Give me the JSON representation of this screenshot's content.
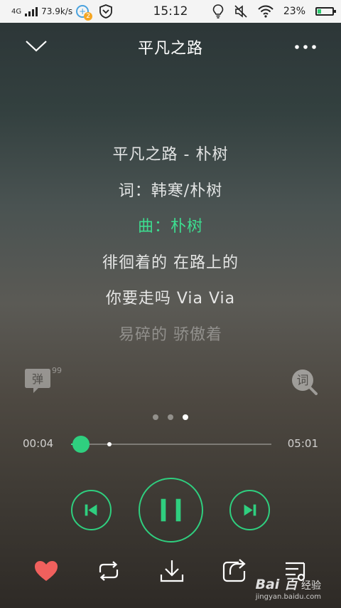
{
  "status_bar": {
    "network": "4G",
    "speed": "73.9k/s",
    "notification_count": "2",
    "time": "15:12",
    "battery_percent": "23%",
    "battery_level": 0.23
  },
  "header": {
    "title": "平凡之路"
  },
  "lyrics": [
    "平凡之路 - 朴树",
    "词：韩寒/朴树",
    "曲：朴树",
    "徘徊着的 在路上的",
    "你要走吗 Via Via",
    "易碎的 骄傲着"
  ],
  "active_lyric_index": 2,
  "danmu": {
    "label": "弹",
    "count": "99+"
  },
  "lyric_search": {
    "label": "词"
  },
  "pager": {
    "count": 3,
    "active": 2
  },
  "player": {
    "current_time": "00:04",
    "total_time": "05:01",
    "progress": 0.05,
    "buffered": 0.19
  },
  "watermark": {
    "logo": "Bai 百",
    "label": "经验",
    "url": "jingyan.baidu.com"
  },
  "colors": {
    "accent": "#2fcf7f",
    "heart": "#f0605d"
  },
  "icons": [
    "chevron-down-icon",
    "more-icon",
    "previous-icon",
    "pause-icon",
    "next-icon",
    "heart-icon",
    "repeat-icon",
    "download-icon",
    "share-icon",
    "playlist-icon"
  ]
}
